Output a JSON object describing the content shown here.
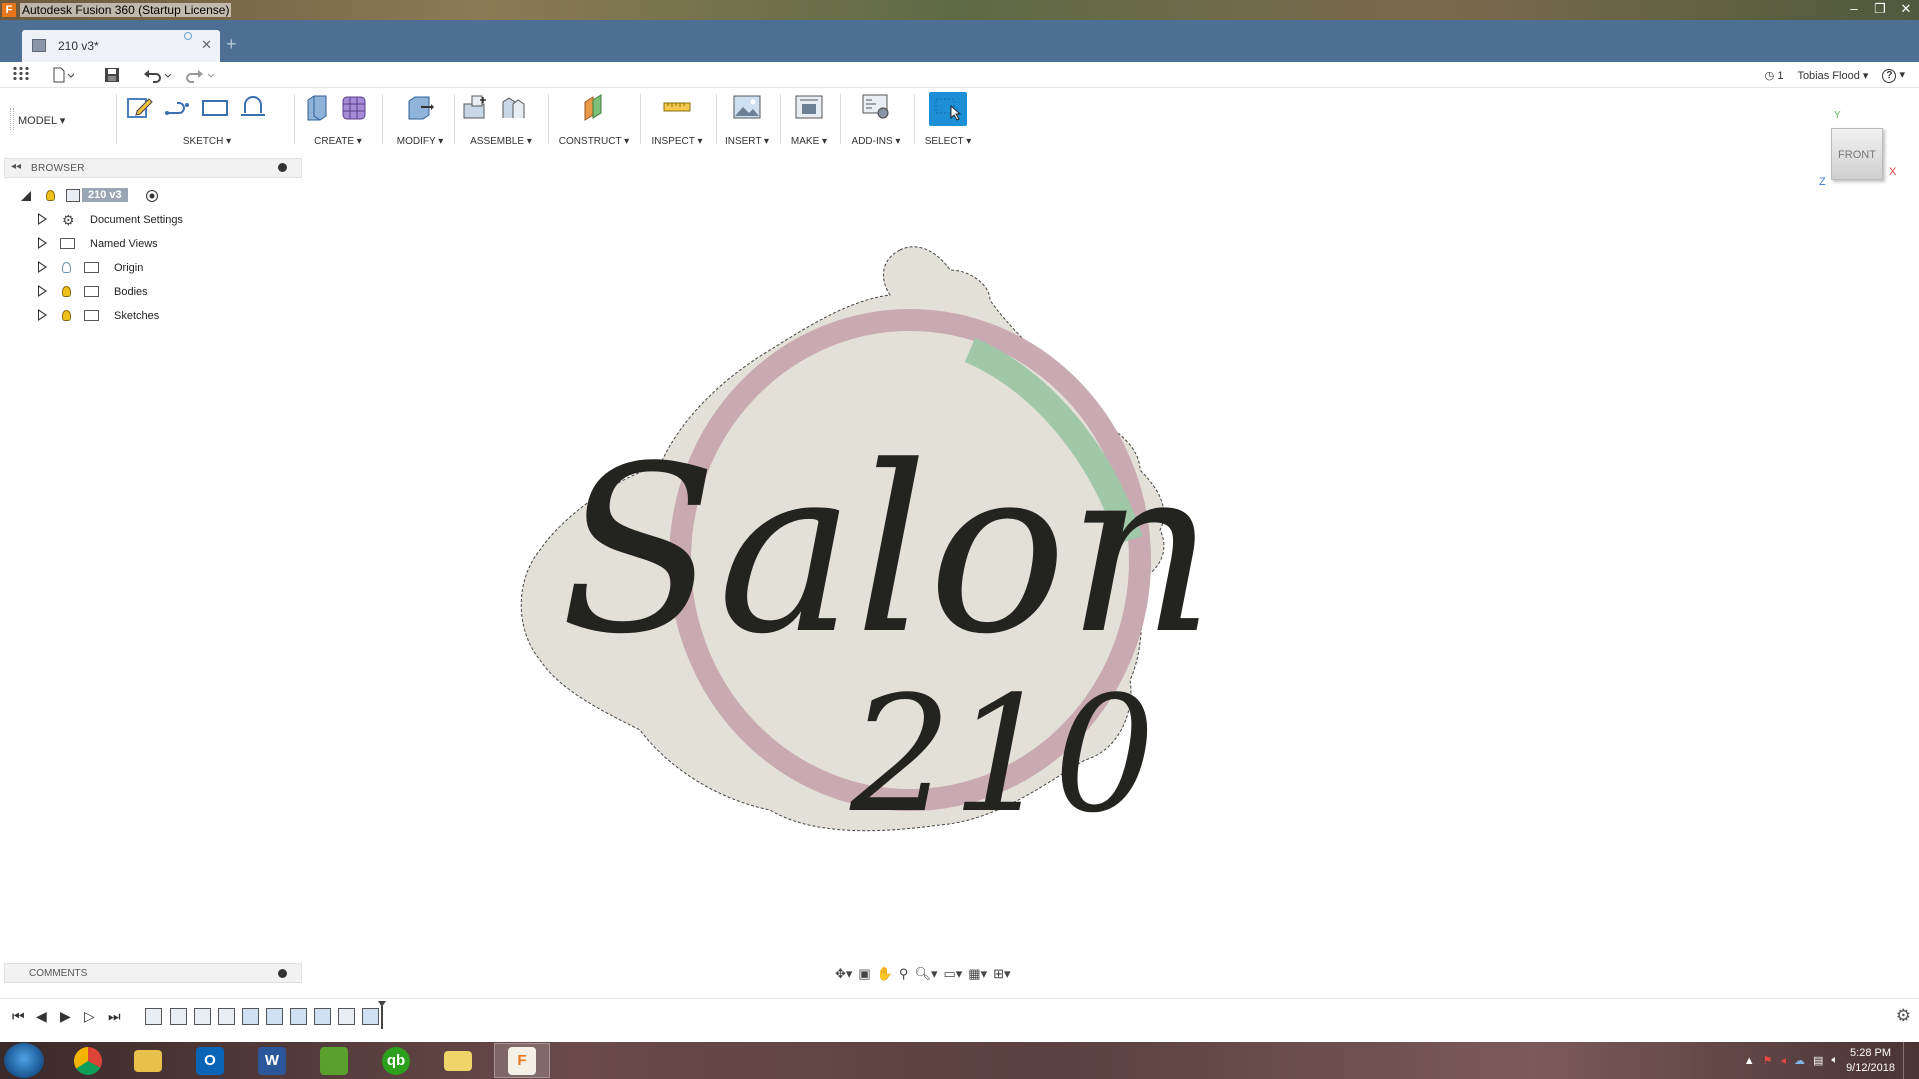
{
  "window": {
    "title": "Autodesk Fusion 360 (Startup License)",
    "controls": [
      "–",
      "❐",
      "✕"
    ]
  },
  "tabs": {
    "document": {
      "name": "210 v3*",
      "close": "✕"
    },
    "new_tab": "+"
  },
  "qat": {
    "job_status": "1",
    "user": "Tobias Flood",
    "help": "?"
  },
  "ribbon": {
    "workspace": "MODEL",
    "groups": [
      {
        "label": "SKETCH"
      },
      {
        "label": "CREATE"
      },
      {
        "label": "MODIFY"
      },
      {
        "label": "ASSEMBLE"
      },
      {
        "label": "CONSTRUCT"
      },
      {
        "label": "INSPECT"
      },
      {
        "label": "INSERT"
      },
      {
        "label": "MAKE"
      },
      {
        "label": "ADD-INS"
      },
      {
        "label": "SELECT"
      }
    ]
  },
  "browser": {
    "title": "BROWSER",
    "root": "210 v3",
    "items": [
      {
        "label": "Document Settings",
        "icon": "gear-icon"
      },
      {
        "label": "Named Views",
        "icon": "folder-icon"
      },
      {
        "label": "Origin",
        "icon": "folder-icon"
      },
      {
        "label": "Bodies",
        "icon": "folder-icon"
      },
      {
        "label": "Sketches",
        "icon": "folder-icon"
      }
    ]
  },
  "viewport": {
    "logo_word": "Salon",
    "logo_number": "210",
    "viewcube_face": "FRONT",
    "axes": {
      "x": "X",
      "y": "Y",
      "z": "Z"
    }
  },
  "comments": {
    "title": "COMMENTS"
  },
  "taskbar": {
    "apps": [
      "chrome-icon",
      "file-explorer-icon",
      "outlook-icon",
      "word-icon",
      "sketchup-layout-icon",
      "quickbooks-icon",
      "folder-icon",
      "fusion-360-icon"
    ],
    "time": "5:28 PM",
    "date": "9/12/2018"
  },
  "colors": {
    "tab_strip": "#4d6f94",
    "select_active": "#1d8fd6",
    "logo_fill": "#e3e0d8",
    "logo_ring_pink": "#c9aab2",
    "logo_ring_green": "#9fc7a8",
    "logo_text": "#232320"
  }
}
